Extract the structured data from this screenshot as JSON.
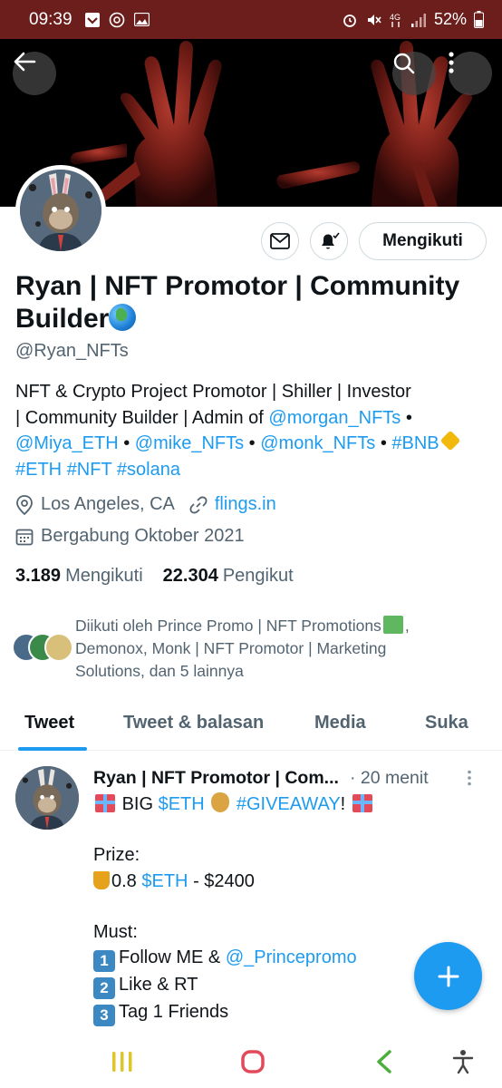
{
  "status_bar": {
    "time": "09:39",
    "battery": "52%",
    "network": "4G"
  },
  "profile": {
    "name": "Ryan | NFT Promotor | Community Builder",
    "handle": "@Ryan_NFTs",
    "follow_button": "Mengikuti",
    "bio": {
      "line1": "NFT & Crypto Project Promotor | Shiller | Investor",
      "line2_prefix": "| Community Builder | Admin of",
      "mention1": "@morgan_NFTs",
      "mention2": "@Miya_ETH",
      "mention3": "@mike_NFTs",
      "mention4": "@monk_NFTs",
      "tag_bnb": "#BNB",
      "tag_eth": "#ETH",
      "tag_nft": "#NFT",
      "tag_solana": "#solana",
      "bullet": "•"
    },
    "location": "Los Angeles, CA",
    "website": "flings.in",
    "joined": "Bergabung Oktober 2021",
    "following_count": "3.189",
    "following_label": "Mengikuti",
    "followers_count": "22.304",
    "followers_label": "Pengikut",
    "followed_by": {
      "line1": "Diikuti oleh Prince Promo | NFT Promotions",
      "line1_end": ",",
      "line2": "Demonox, Monk | NFT Promotor | Marketing",
      "line3": "Solutions, dan 5 lainnya"
    }
  },
  "tabs": [
    {
      "label": "Tweet",
      "active": true
    },
    {
      "label": "Tweet & balasan",
      "active": false
    },
    {
      "label": "Media",
      "active": false
    },
    {
      "label": "Suka",
      "active": false
    }
  ],
  "tweet": {
    "author": "Ryan | NFT Promotor | Com...",
    "time": "· 20 menit",
    "big": "BIG",
    "cashtag_eth": "$ETH",
    "giveaway": "#GIVEAWAY",
    "exclaim": "!",
    "prize_label": "Prize:",
    "prize_amount": "0.8",
    "prize_price": "- $2400",
    "must_label": "Must:",
    "step1_prefix": "Follow ME &",
    "step1_mention": "@_Princepromo",
    "step2": "Like & RT",
    "step3": "Tag 1 Friends",
    "keycaps": [
      "1",
      "2",
      "3"
    ]
  },
  "colors": {
    "accent": "#1d9bf0",
    "status_bar": "#6b1e1b",
    "text_primary": "#0f1419",
    "text_secondary": "#536471"
  }
}
